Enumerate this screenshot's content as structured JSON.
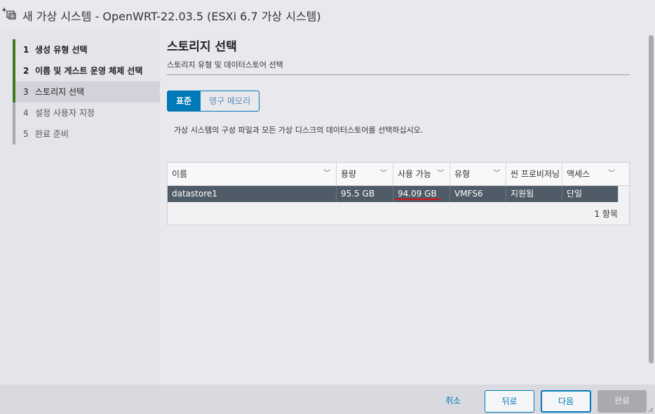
{
  "window": {
    "title": "새 가상 시스템 - OpenWRT-22.03.5 (ESXi 6.7 가상 시스템)"
  },
  "steps": [
    {
      "num": "1",
      "label": "생성 유형 선택",
      "state": "done"
    },
    {
      "num": "2",
      "label": "이름 및 게스트 운영 체제 선택",
      "state": "done"
    },
    {
      "num": "3",
      "label": "스토리지 선택",
      "state": "active"
    },
    {
      "num": "4",
      "label": "설정 사용자 지정",
      "state": "todo"
    },
    {
      "num": "5",
      "label": "완료 준비",
      "state": "todo"
    }
  ],
  "main": {
    "title": "스토리지 선택",
    "subtitle": "스토리지 유형 및 데이터스토어 선택",
    "tabs": [
      {
        "label": "표준",
        "selected": true
      },
      {
        "label": "영구 메모리",
        "selected": false
      }
    ],
    "description": "가상 시스템의 구성 파일과 모든 가상 디스크의 데이터스토어를 선택하십시오."
  },
  "grid": {
    "columns": [
      "이름",
      "용량",
      "사용 가능",
      "유형",
      "씬 프로비저닝",
      "액세스"
    ],
    "rows": [
      [
        "datastore1",
        "95.5 GB",
        "94.09 GB",
        "VMFS6",
        "지원됨",
        "단일"
      ]
    ],
    "footer": "1 항목"
  },
  "footer": {
    "cancel": "취소",
    "back": "뒤로",
    "next": "다음",
    "finish": "완료"
  },
  "colors": {
    "accent": "#0079b8",
    "step_done": "#3c7d17",
    "selected_row": "#4f5b66",
    "highlight": "#d41414"
  }
}
